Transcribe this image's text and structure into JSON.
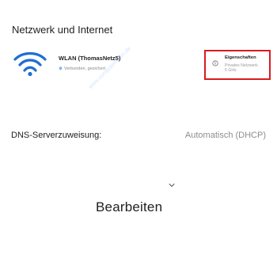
{
  "section_title": "Netzwerk und Internet",
  "network": {
    "name": "WLAN (ThomasNetz5)",
    "status": "Verbunden, gesichert",
    "icon": "wifi-icon",
    "status_icon": "shield-icon"
  },
  "properties": {
    "title": "Eigenschaften",
    "subtitle_line1": "Privates Netzwerk",
    "subtitle_line2": "5 GHz",
    "icon": "info-icon",
    "highlight_color": "#d81b20"
  },
  "dns": {
    "label": "DNS-Serverzuweisung:",
    "value": "Automatisch (DHCP)"
  },
  "actions": {
    "edit_label": "Bearbeiten",
    "chevron_icon": "chevron-down-icon"
  },
  "watermark": "www.computerhilfen.de",
  "colors": {
    "wifi": "#1f6fd1",
    "muted": "#8e8e8e",
    "highlight": "#d81b20"
  }
}
